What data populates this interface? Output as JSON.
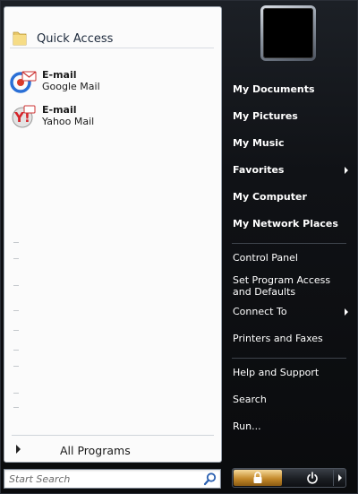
{
  "quick_access": {
    "label": "Quick Access"
  },
  "pinned": [
    {
      "title": "E-mail",
      "subtitle": "Google Mail",
      "icon": "google-mail-icon"
    },
    {
      "title": "E-mail",
      "subtitle": "Yahoo Mail",
      "icon": "yahoo-mail-icon"
    }
  ],
  "all_programs": {
    "label": "All Programs"
  },
  "search": {
    "placeholder": "Start Search",
    "icon": "search-icon"
  },
  "right": {
    "group1": [
      {
        "label": "My Documents"
      },
      {
        "label": "My Pictures"
      },
      {
        "label": "My Music"
      },
      {
        "label": "Favorites"
      },
      {
        "label": "My Computer"
      },
      {
        "label": "My Network Places"
      }
    ],
    "group2": [
      {
        "label": "Control Panel"
      },
      {
        "label": "Set Program Access and Defaults"
      },
      {
        "label": "Connect To"
      },
      {
        "label": "Printers and Faxes"
      }
    ],
    "group3": [
      {
        "label": "Help and Support"
      },
      {
        "label": "Search"
      },
      {
        "label": "Run..."
      }
    ]
  },
  "power": {
    "lock_icon": "lock-icon",
    "power_icon": "power-icon",
    "arrow_icon": "chevron-right-icon"
  },
  "colors": {
    "accent_lock": "#c48a2b",
    "panel_bg": "#fbfbfb",
    "dark_bg": "#0b0c0e"
  }
}
